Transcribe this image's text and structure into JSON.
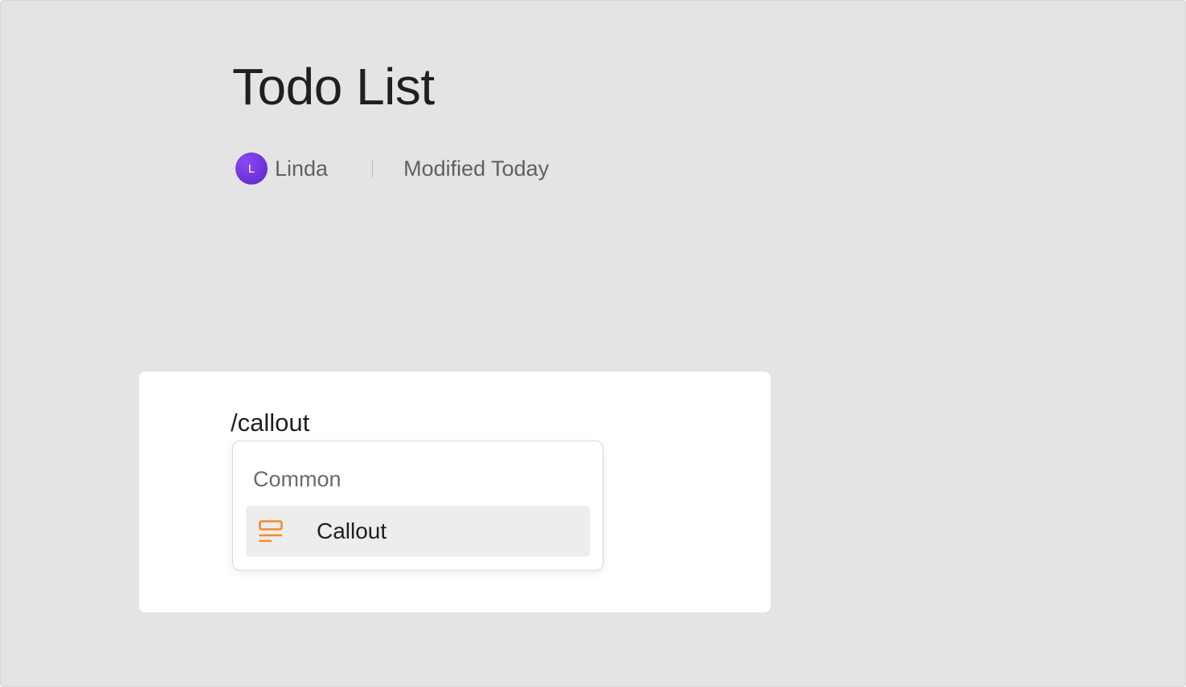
{
  "document": {
    "title": "Todo List",
    "author_initial": "L",
    "author": "Linda",
    "modified": "Modified Today"
  },
  "editor": {
    "command_text": "/callout"
  },
  "slash_menu": {
    "section_label": "Common",
    "items": [
      {
        "label": "Callout",
        "icon": "callout-icon",
        "icon_color": "#f28c2a"
      }
    ]
  },
  "colors": {
    "background": "#e4e4e4",
    "avatar": "#6a2fd6",
    "accent_orange": "#f28c2a"
  }
}
